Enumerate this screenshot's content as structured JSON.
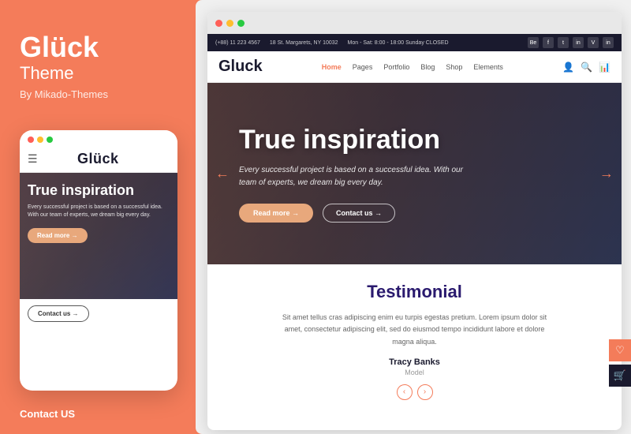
{
  "brand": {
    "name": "Glück",
    "subtitle": "Theme",
    "by": "By Mikado-Themes"
  },
  "left_panel": {
    "contact_label": "Contact US"
  },
  "mobile_mockup": {
    "dots": [
      "red",
      "yellow",
      "green"
    ],
    "logo": "Glück",
    "hero_title": "True inspiration",
    "hero_text": "Every successful project is based on a successful idea. With our team of experts, we dream big every day.",
    "btn_readmore": "Read more →",
    "btn_contact": "Contact us →"
  },
  "desktop": {
    "browser_dots": [
      "red",
      "yellow",
      "green"
    ],
    "infobar": {
      "phone": "(+88) 11 223 4567",
      "address": "18 St. Margarets, NY 10032",
      "hours": "Mon - Sat: 8:00 - 18:00 Sunday CLOSED",
      "socials": [
        "Be",
        "f",
        "t",
        "in",
        "V",
        "in"
      ]
    },
    "navbar": {
      "logo": "Gluck",
      "links": [
        "Home",
        "Pages",
        "Portfolio",
        "Blog",
        "Shop",
        "Elements"
      ],
      "active_link": "Home"
    },
    "hero": {
      "title": "True inspiration",
      "subtitle": "Every successful project is based on a successful idea. With our team of experts, we dream big every day.",
      "btn_readmore": "Read more →",
      "btn_contact": "Contact us →",
      "arrow_left": "←",
      "arrow_right": "→"
    },
    "testimonial": {
      "title": "Testimonial",
      "text": "Sit amet tellus cras adipiscing enim eu turpis egestas pretium. Lorem ipsum dolor sit amet, consectetur adipiscing elit, sed do eiusmod tempo incididunt labore et dolore magna aliqua.",
      "author": "Tracy Banks",
      "role": "Model",
      "nav_prev": "‹",
      "nav_next": "›"
    }
  },
  "colors": {
    "accent": "#f47c5a",
    "dark": "#1a1a2e",
    "white": "#ffffff"
  }
}
